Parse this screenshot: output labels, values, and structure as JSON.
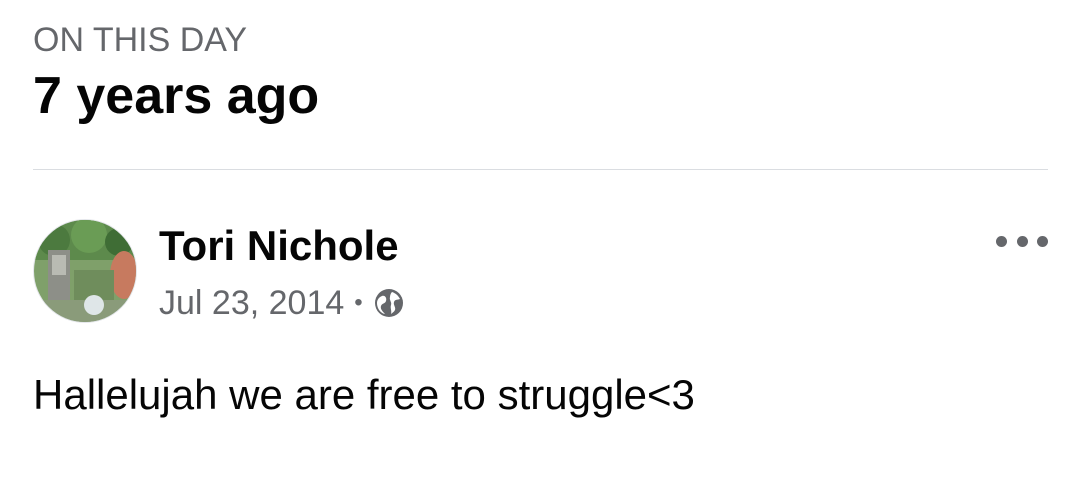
{
  "memory": {
    "kicker": "ON THIS DAY",
    "headline": "7 years ago"
  },
  "post": {
    "author": "Tori Nichole",
    "date": "Jul 23, 2014",
    "separator": "•",
    "audience_icon": "globe-icon",
    "more_icon": "more-options-icon",
    "text": "Hallelujah we are free to struggle<3"
  },
  "colors": {
    "primary_text": "#050505",
    "secondary_text": "#65676b",
    "divider": "#dadde1"
  }
}
